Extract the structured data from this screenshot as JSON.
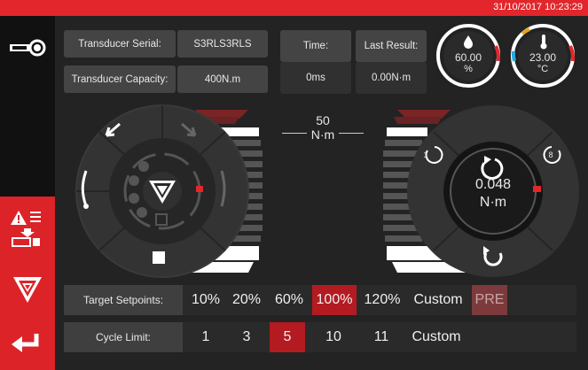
{
  "status_bar": {
    "datetime": "31/10/2017 10:23:29",
    "accent": "#e2262b"
  },
  "sidebar": {
    "items": [
      {
        "icon": "transducer-connect-icon"
      },
      {
        "icon": "alert-log-icon"
      },
      {
        "icon": "brand-logo-icon"
      },
      {
        "icon": "back-arrow-icon"
      }
    ]
  },
  "info": {
    "serial_label": "Transducer Serial:",
    "serial_value": "S3RLS3RLS",
    "capacity_label": "Transducer Capacity:",
    "capacity_value": "400N.m",
    "time_label": "Time:",
    "time_value": "0ms",
    "last_result_label": "Last Result:",
    "last_result_value": "0.00N·m"
  },
  "gauges": {
    "humidity": {
      "value": "60.00",
      "unit": "%",
      "icon": "humidity-drop-icon"
    },
    "temperature": {
      "value": "23.00",
      "unit": "°C",
      "icon": "thermometer-icon"
    }
  },
  "target": {
    "value": "50",
    "unit": "N·m"
  },
  "reading": {
    "value": "0.048",
    "unit": "N·m"
  },
  "setpoints": {
    "label": "Target Setpoints:",
    "options": [
      "10%",
      "20%",
      "60%",
      "100%",
      "120%",
      "Custom",
      "PRE"
    ],
    "selected": "100%"
  },
  "cycle_limit": {
    "label": "Cycle Limit:",
    "options": [
      "1",
      "3",
      "5",
      "10",
      "11",
      "Custom"
    ],
    "selected": "5"
  },
  "counters": {
    "left": "1",
    "right": "8"
  }
}
